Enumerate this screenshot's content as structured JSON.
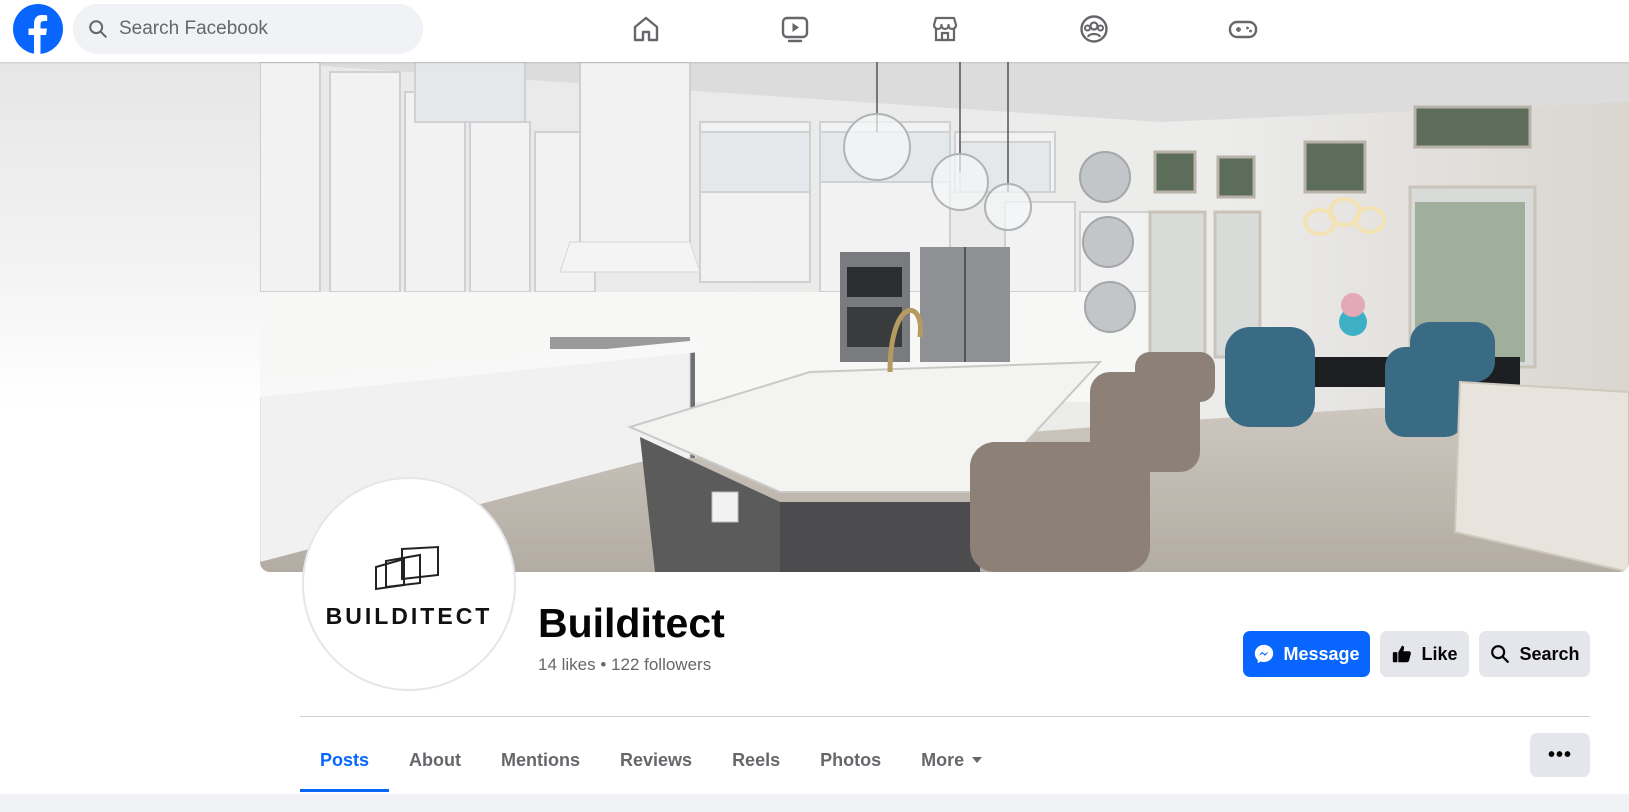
{
  "topbar": {
    "search_placeholder": "Search Facebook",
    "nav_icons": [
      "home-icon",
      "video-icon",
      "marketplace-icon",
      "groups-icon",
      "gaming-icon"
    ]
  },
  "profile": {
    "logo_text": "BUILDITECT",
    "name": "Builditect",
    "stats": "14 likes • 122 followers"
  },
  "actions": {
    "message_label": "Message",
    "like_label": "Like",
    "search_label": "Search",
    "more_dots": "•••"
  },
  "tabs": [
    {
      "label": "Posts",
      "active": true
    },
    {
      "label": "About"
    },
    {
      "label": "Mentions"
    },
    {
      "label": "Reviews"
    },
    {
      "label": "Reels"
    },
    {
      "label": "Photos"
    },
    {
      "label": "More"
    }
  ],
  "colors": {
    "brand": "#0866ff",
    "button_gray": "#e4e6eb",
    "text_secondary": "#65676b"
  }
}
